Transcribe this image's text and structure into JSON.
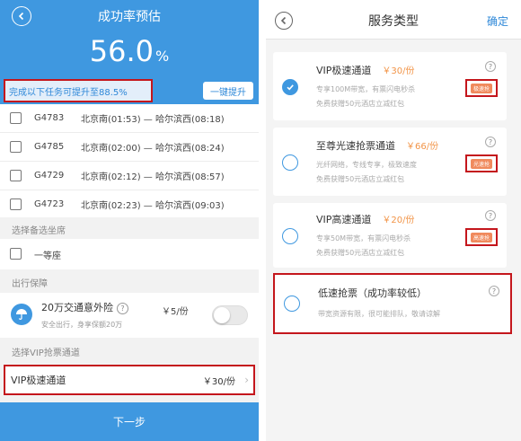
{
  "left": {
    "header": {
      "title": "成功率预估"
    },
    "rate": {
      "value": "56.0",
      "unit": "%"
    },
    "boost": {
      "text": "完成以下任务可提升至88.5%",
      "button": "一键提升"
    },
    "trains": [
      {
        "no": "G4783",
        "route": "北京南(01:53) — 哈尔滨西(08:18)"
      },
      {
        "no": "G4785",
        "route": "北京南(02:00) — 哈尔滨西(08:24)"
      },
      {
        "no": "G4729",
        "route": "北京南(02:12) — 哈尔滨西(08:57)"
      },
      {
        "no": "G4723",
        "route": "北京南(02:23) — 哈尔滨西(09:03)"
      }
    ],
    "seat_section": {
      "label": "选择备选坐席",
      "option": "一等座"
    },
    "insurance_section": {
      "label": "出行保障",
      "title": "20万交通意外险",
      "help": "?",
      "subtitle": "安全出行，身享保额20万",
      "price": "￥5/份"
    },
    "vip_section": {
      "label": "选择VIP抢票通道",
      "item": "VIP极速通道",
      "price": "￥30/份"
    },
    "next_button": "下一步"
  },
  "right": {
    "header": {
      "title": "服务类型",
      "confirm": "确定"
    },
    "options": [
      {
        "title": "VIP极速通道",
        "price": "￥30/份",
        "line1": "专享100M带宽，有票闪电秒杀",
        "line2": "免费获赠50元酒店立减红包",
        "badge": "极速抢",
        "help": "?",
        "selected": true
      },
      {
        "title": "至尊光速抢票通道",
        "price": "￥66/份",
        "line1": "光纤网络，专线专享，极致速度",
        "line2": "免费获赠50元酒店立减红包",
        "badge": "光速抢",
        "help": "?",
        "selected": false
      },
      {
        "title": "VIP高速通道",
        "price": "￥20/份",
        "line1": "专享50M带宽，有票闪电秒杀",
        "line2": "免费获赠50元酒店立减红包",
        "badge": "高速抢",
        "help": "?",
        "selected": false
      },
      {
        "title": "低速抢票（成功率较低）",
        "line1": "带宽资源有限，很可能排队，敬请谅解",
        "help": "?",
        "selected": false
      }
    ]
  },
  "colors": {
    "primary": "#3f98e0",
    "highlight_border": "#c4161c",
    "price": "#f29447",
    "badge": "#f08a5d"
  }
}
